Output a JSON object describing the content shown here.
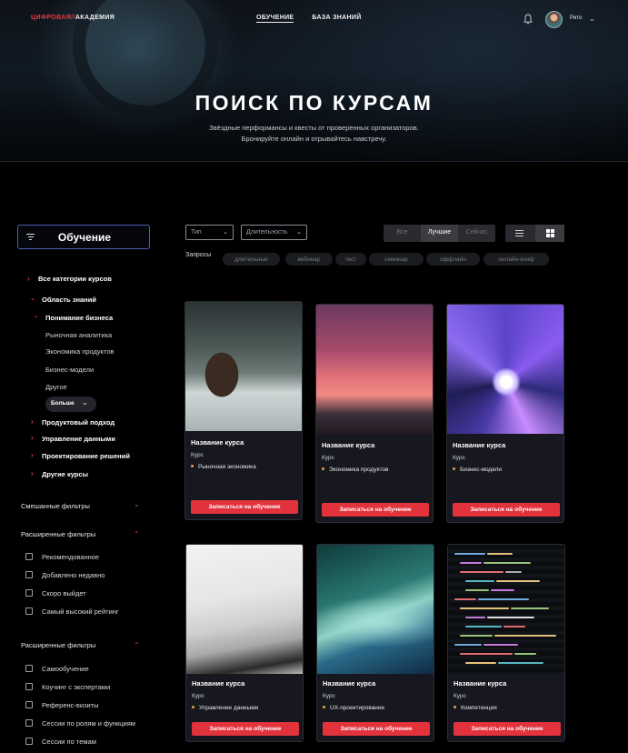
{
  "brand": {
    "part1": "ЦИФРОВАЯ",
    "separator": "//",
    "part2": "АКАДЕМИЯ"
  },
  "nav": [
    {
      "label": "ОБУЧЕНИЕ",
      "active": true
    },
    {
      "label": "БАЗА ЗНАНИЙ",
      "active": false
    }
  ],
  "user": {
    "name": "Рито",
    "icons": [
      "bell-icon",
      "avatar",
      "chevron-down-icon"
    ]
  },
  "hero": {
    "title": "ПОИСК ПО КУРСАМ",
    "subtitle_line1": "Звёздные перформансы и квесты от проверенных организаторов.",
    "subtitle_line2": "Бронируйте онлайн и отрывайтесь навстречу."
  },
  "sidebar": {
    "heading": "Обучение",
    "tree": [
      {
        "label": "Все категории курсов",
        "level": 0,
        "caret": "right",
        "bold": true
      },
      {
        "label": "Область знаний",
        "level": 0,
        "caret": "down",
        "bold": true
      },
      {
        "label": "Понимание бизнеса",
        "level": 1,
        "caret": "down",
        "bold": true
      },
      {
        "label": "Рыночная аналитика",
        "level": 2
      },
      {
        "label": "Экономика продуктов",
        "level": 2
      },
      {
        "label": "Бизнес-модели",
        "level": 2
      },
      {
        "label": "Другое",
        "level": 2
      },
      {
        "label": "Продуктовый подход",
        "level": 1,
        "caret": "right",
        "bold": true
      },
      {
        "label": "Управление данными",
        "level": 1,
        "caret": "right",
        "bold": true
      },
      {
        "label": "Проектирование решений",
        "level": 1,
        "caret": "right",
        "bold": true
      },
      {
        "label": "Другие курсы",
        "level": 1,
        "caret": "right",
        "bold": true
      }
    ],
    "more_label": "Больше",
    "sections": [
      {
        "title": "Смешанные фильтры",
        "expanded": false,
        "chevron_color": "#4a72d8",
        "options": []
      },
      {
        "title": "Расширенные фильтры",
        "expanded": true,
        "chevron_color": "#e53b44",
        "options": [
          "Рекомендованное",
          "Добавлено недавно",
          "Скоро выйдет",
          "Самый высокий рейтинг"
        ]
      },
      {
        "title": "Расширенные фильтры",
        "expanded": true,
        "chevron_color": "#e53b44",
        "options": [
          "Самообучение",
          "Коучинг с экспертами",
          "Референс-визиты",
          "Сессии по ролям и функциям",
          "Сессии по темам"
        ]
      }
    ]
  },
  "filters": {
    "type_placeholder": "Тип",
    "duration_placeholder": "Длительность",
    "segments": [
      {
        "label": "Все",
        "active": false
      },
      {
        "label": "Лучшие",
        "active": true
      },
      {
        "label": "Сейчас",
        "active": false
      }
    ],
    "view_modes": [
      {
        "icon": "list-icon",
        "active": false
      },
      {
        "icon": "grid-icon",
        "active": true
      }
    ],
    "requests_label": "Запросы",
    "chips": [
      "длительные",
      "вебинар",
      "тест",
      "семинар",
      "оффлайн",
      "онлайн-конф"
    ]
  },
  "cards": [
    {
      "title": "Название курса",
      "type": "Курс",
      "tag": "Рыночная экономика",
      "button": "Записаться на обучение",
      "image": "office-monitors-image"
    },
    {
      "title": "Название курса",
      "type": "Курс",
      "tag": "Экономика продуктов",
      "button": "Записаться на обучение",
      "image": "desk-monitor-image"
    },
    {
      "title": "Название курса",
      "type": "Курс",
      "tag": "Бизнес-модели",
      "button": "Записаться на обучение",
      "image": "tunnel-lights-image"
    },
    {
      "title": "Название курса",
      "type": "Курс",
      "tag": "Управление данными",
      "button": "Записаться на обучение",
      "image": "laptop-keyboard-image"
    },
    {
      "title": "Название курса",
      "type": "Курс",
      "tag": "UX-проектирование",
      "button": "Записаться на обучение",
      "image": "fiber-optic-image"
    },
    {
      "title": "Название курса",
      "type": "Курс",
      "tag": "Компетенция",
      "button": "Записаться на обучение",
      "image": "code-screen-image"
    }
  ],
  "colors": {
    "accent": "#e2323c",
    "brand_red": "#e53b44",
    "focus_border": "#4b62b4",
    "background": "#000000",
    "card_bg": "#17181f"
  }
}
